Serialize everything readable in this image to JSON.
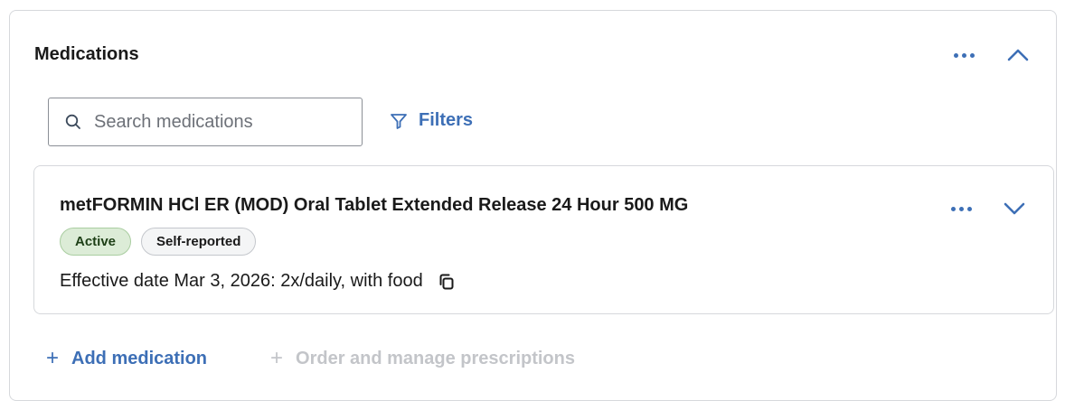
{
  "panel": {
    "title": "Medications",
    "more_icon": "more-horizontal-icon",
    "collapse_icon": "chevron-up-icon"
  },
  "search": {
    "placeholder": "Search medications",
    "value": "",
    "icon": "search-icon"
  },
  "filters": {
    "label": "Filters",
    "icon": "filter-icon"
  },
  "medications": [
    {
      "name": "metFORMIN HCl ER (MOD) Oral Tablet Extended Release 24 Hour 500 MG",
      "badges": [
        "Active",
        "Self-reported"
      ],
      "detail": "Effective date Mar 3, 2026: 2x/daily, with food",
      "copy_icon": "copy-icon",
      "expand_icon": "chevron-down-icon"
    }
  ],
  "actions": {
    "add_medication": "Add medication",
    "order_prescriptions": "Order and manage prescriptions"
  },
  "colors": {
    "accent": "#3d6fb6",
    "active_badge_bg": "#dcecd7",
    "border": "#d6d8dc",
    "disabled": "#c3c5c9"
  }
}
